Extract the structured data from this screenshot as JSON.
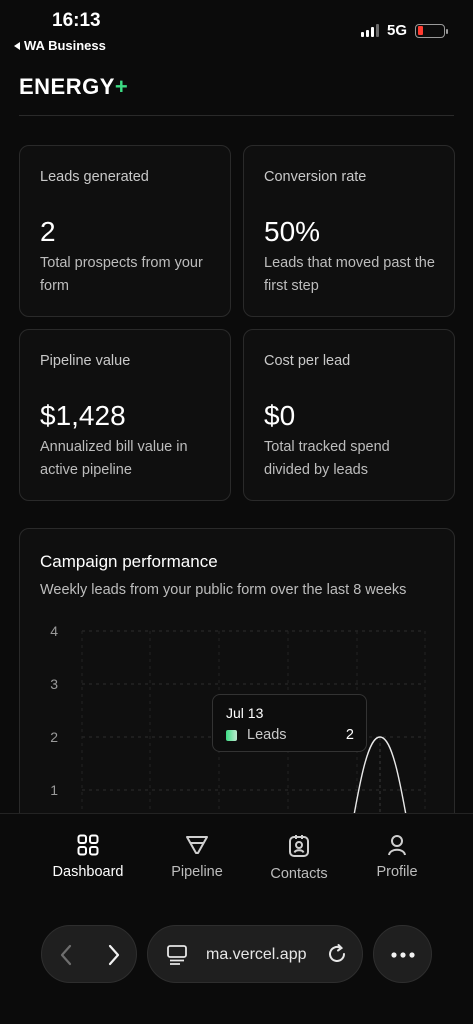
{
  "status_bar": {
    "time": "16:13",
    "back_label": "WA Business",
    "network": "5G"
  },
  "brand": {
    "name": "ENERGY",
    "plus": "+"
  },
  "metrics": [
    {
      "label": "Leads generated",
      "value": "2",
      "desc": "Total prospects from your form"
    },
    {
      "label": "Conversion rate",
      "value": "50%",
      "desc": "Leads that moved past the first step"
    },
    {
      "label": "Pipeline value",
      "value": "$1,428",
      "desc": "Annualized bill value in active pipeline"
    },
    {
      "label": "Cost per lead",
      "value": "$0",
      "desc": "Total tracked spend divided by leads"
    }
  ],
  "campaign": {
    "title": "Campaign performance",
    "subtitle": "Weekly leads from your public form over the last 8 weeks",
    "tooltip": {
      "date": "Jul 13",
      "series": "Leads",
      "value": "2"
    }
  },
  "chart_data": {
    "type": "area",
    "title": "Campaign performance",
    "subtitle": "Weekly leads from your public form over the last 8 weeks",
    "ylim": [
      0,
      4
    ],
    "yticks": [
      1,
      2,
      3,
      4
    ],
    "grid": true,
    "series": [
      {
        "name": "Leads",
        "points": [
          {
            "x": "Jul 13",
            "y": 2
          }
        ]
      }
    ]
  },
  "tabs": [
    {
      "label": "Dashboard",
      "icon": "grid-icon",
      "active": true
    },
    {
      "label": "Pipeline",
      "icon": "funnel-icon",
      "active": false
    },
    {
      "label": "Contacts",
      "icon": "contact-card-icon",
      "active": false
    },
    {
      "label": "Profile",
      "icon": "person-icon",
      "active": false
    }
  ],
  "browser": {
    "url": "ma.vercel.app"
  },
  "colors": {
    "accent": "#3ddc84",
    "background": "#0b0b0b",
    "card_border": "#2a2a2a",
    "battery_low": "#ff3b30"
  }
}
